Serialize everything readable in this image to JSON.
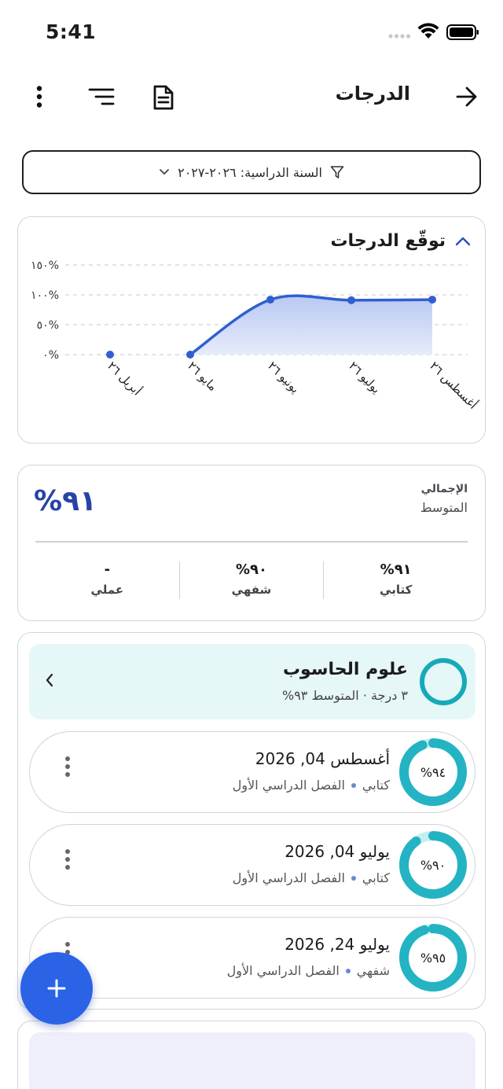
{
  "status": {
    "time": "5:41"
  },
  "header": {
    "title": "الدرجات"
  },
  "filter": {
    "label": "السنة الدراسية: ٢٠٢٦-٢٠٢٧"
  },
  "chart_card": {
    "title": "توقّع الدرجات"
  },
  "chart_data": {
    "type": "area",
    "categories": [
      "أبريل ٢٦",
      "مايو ٢٦",
      "يونيو ٢٦",
      "يوليو ٢٦",
      "أغسطس ٢٦"
    ],
    "values": [
      0,
      0,
      92,
      91,
      92
    ],
    "y_ticks": [
      "٠%",
      "٥٠%",
      "١٠٠%",
      "١٥٠%"
    ],
    "ylim": [
      0,
      150
    ],
    "grid": true,
    "color": "#2f5fd0"
  },
  "summary": {
    "overall_label": "الإجمالي",
    "average_label": "المتوسط",
    "overall_value": "٩١%",
    "columns": [
      {
        "value": "٩١%",
        "label": "كتابي"
      },
      {
        "value": "٩٠%",
        "label": "شفهي"
      },
      {
        "value": "-",
        "label": "عملي"
      }
    ]
  },
  "subject": {
    "name": "علوم الحاسوب",
    "meta": "٣ درجة · المتوسط ٩٣%",
    "ring_color": "#16aab8"
  },
  "grades": [
    {
      "date": "أغسطس 04, 2026",
      "type": "كتابي",
      "term": "الفصل الدراسي الأول",
      "percent_label": "٩٤%",
      "percent": 94
    },
    {
      "date": "يوليو 04, 2026",
      "type": "كتابي",
      "term": "الفصل الدراسي الأول",
      "percent_label": "٩٠%",
      "percent": 90
    },
    {
      "date": "يوليو 24, 2026",
      "type": "شفهي",
      "term": "الفصل الدراسي الأول",
      "percent_label": "٩٥%",
      "percent": 95
    }
  ],
  "icons": {
    "back": "arrow-right-icon",
    "doc": "document-icon",
    "sort": "sort-icon",
    "more": "more-vert-icon",
    "filter": "filter-icon",
    "fab": "plus-icon"
  }
}
